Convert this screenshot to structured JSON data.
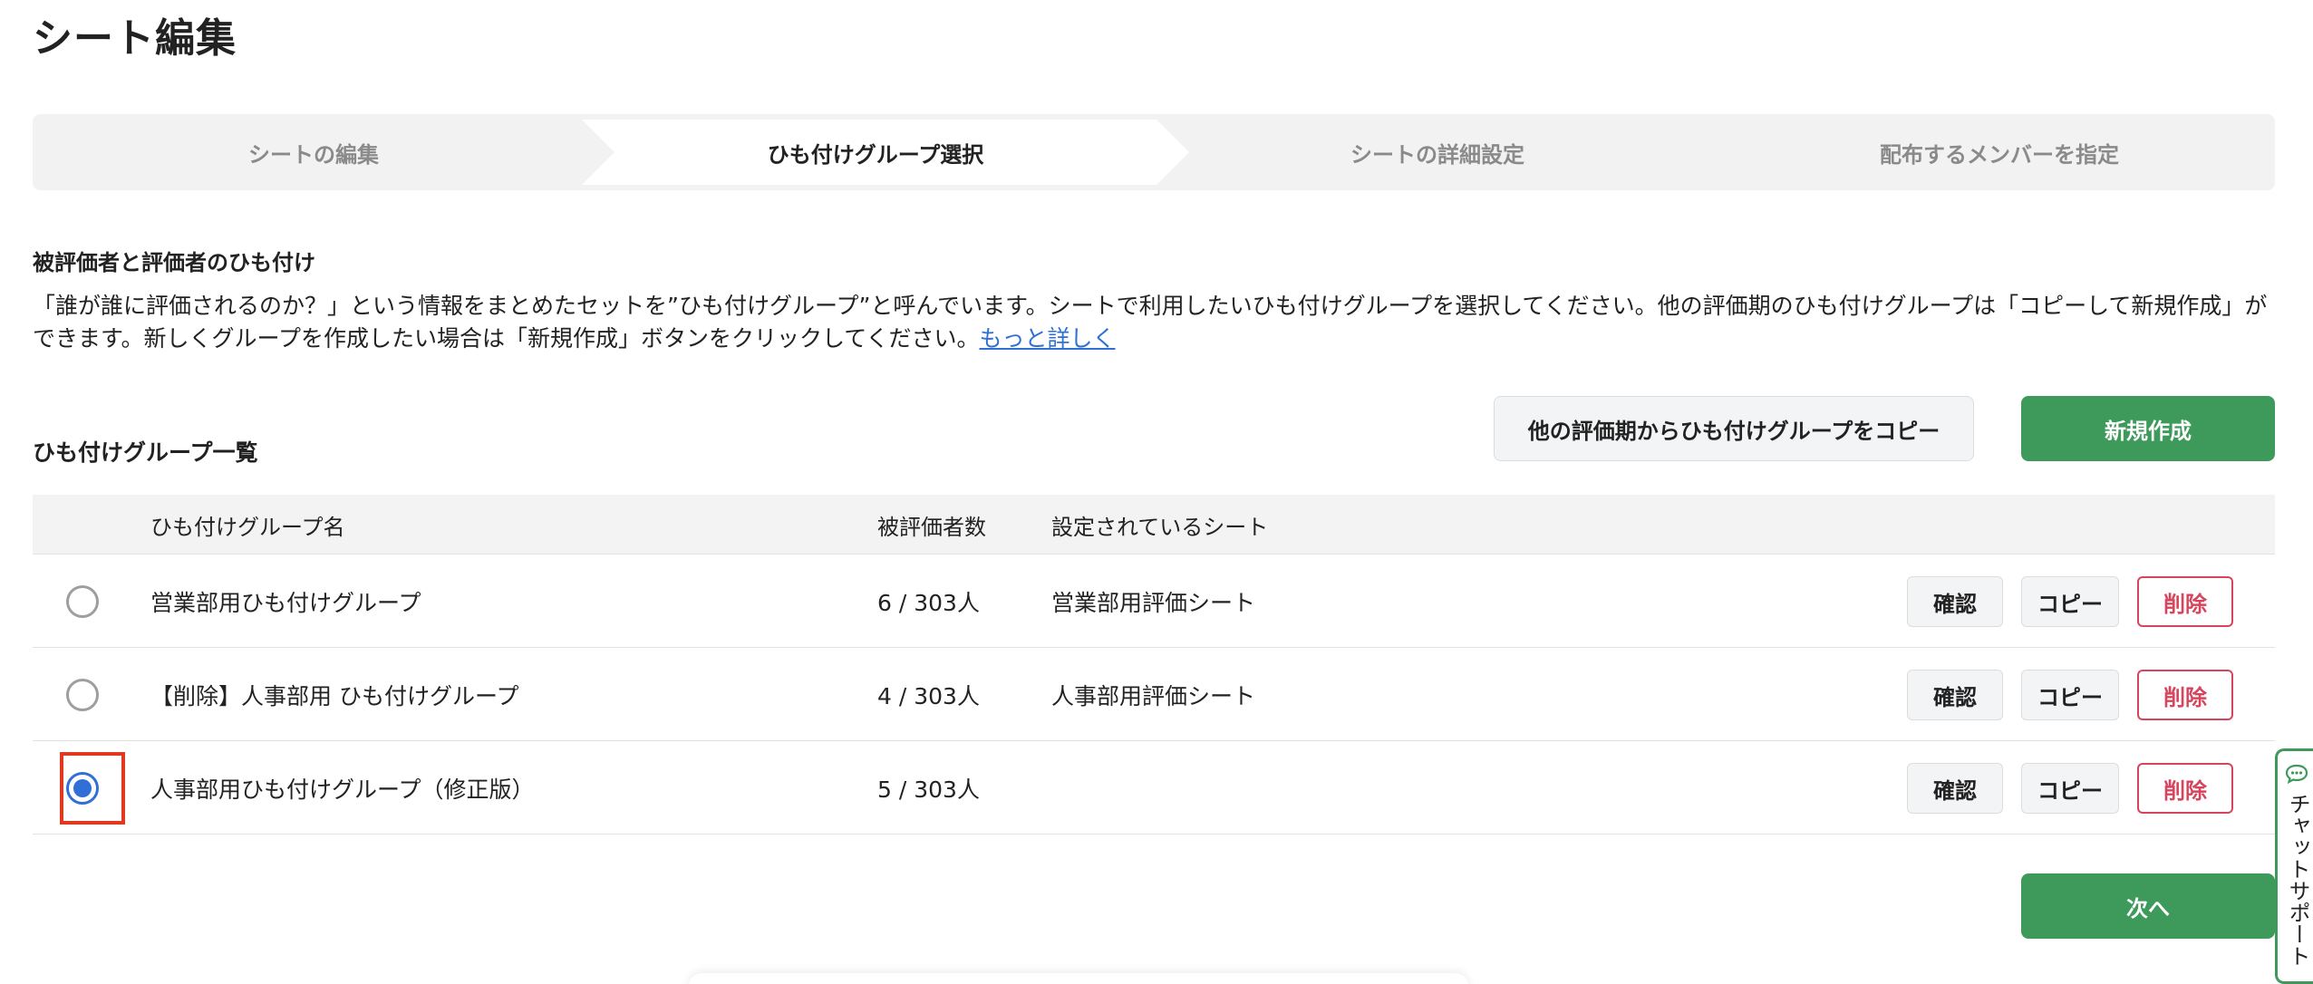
{
  "page": {
    "title": "シート編集"
  },
  "stepper": {
    "steps": [
      "シートの編集",
      "ひも付けグループ選択",
      "シートの詳細設定",
      "配布するメンバーを指定"
    ],
    "active_index": 1
  },
  "section": {
    "heading": "被評価者と評価者のひも付け",
    "description": "「誰が誰に評価されるのか？」という情報をまとめたセットを”ひも付けグループ”と呼んでいます。シートで利用したいひも付けグループを選択してください。他の評価期のひも付けグループは「コピーして新規作成」ができます。新しくグループを作成したい場合は「新規作成」ボタンをクリックしてください。",
    "more_link": "もっと詳しく"
  },
  "list": {
    "heading": "ひも付けグループ一覧",
    "copy_from_label": "他の評価期からひも付けグループをコピー",
    "new_label": "新規作成",
    "columns": {
      "name": "ひも付けグループ名",
      "count": "被評価者数",
      "sheet": "設定されているシート"
    },
    "rows": [
      {
        "name": "営業部用ひも付けグループ",
        "count": "6 / 303人",
        "sheet": "営業部用評価シート",
        "selected": false
      },
      {
        "name": "【削除】人事部用 ひも付けグループ",
        "count": "4 / 303人",
        "sheet": "人事部用評価シート",
        "selected": false
      },
      {
        "name": "人事部用ひも付けグループ（修正版）",
        "count": "5 / 303人",
        "sheet": "",
        "selected": true
      }
    ],
    "row_actions": {
      "confirm": "確認",
      "copy": "コピー",
      "delete": "削除"
    }
  },
  "footer": {
    "next_label": "次へ"
  },
  "chat_support": {
    "label": "チャットサポート",
    "icon": "chat-bubble-icon"
  },
  "colors": {
    "primary_green": "#3d9a5b",
    "link_blue": "#2f6fd6",
    "danger_red": "#d6455d",
    "highlight": "#e0391f"
  }
}
